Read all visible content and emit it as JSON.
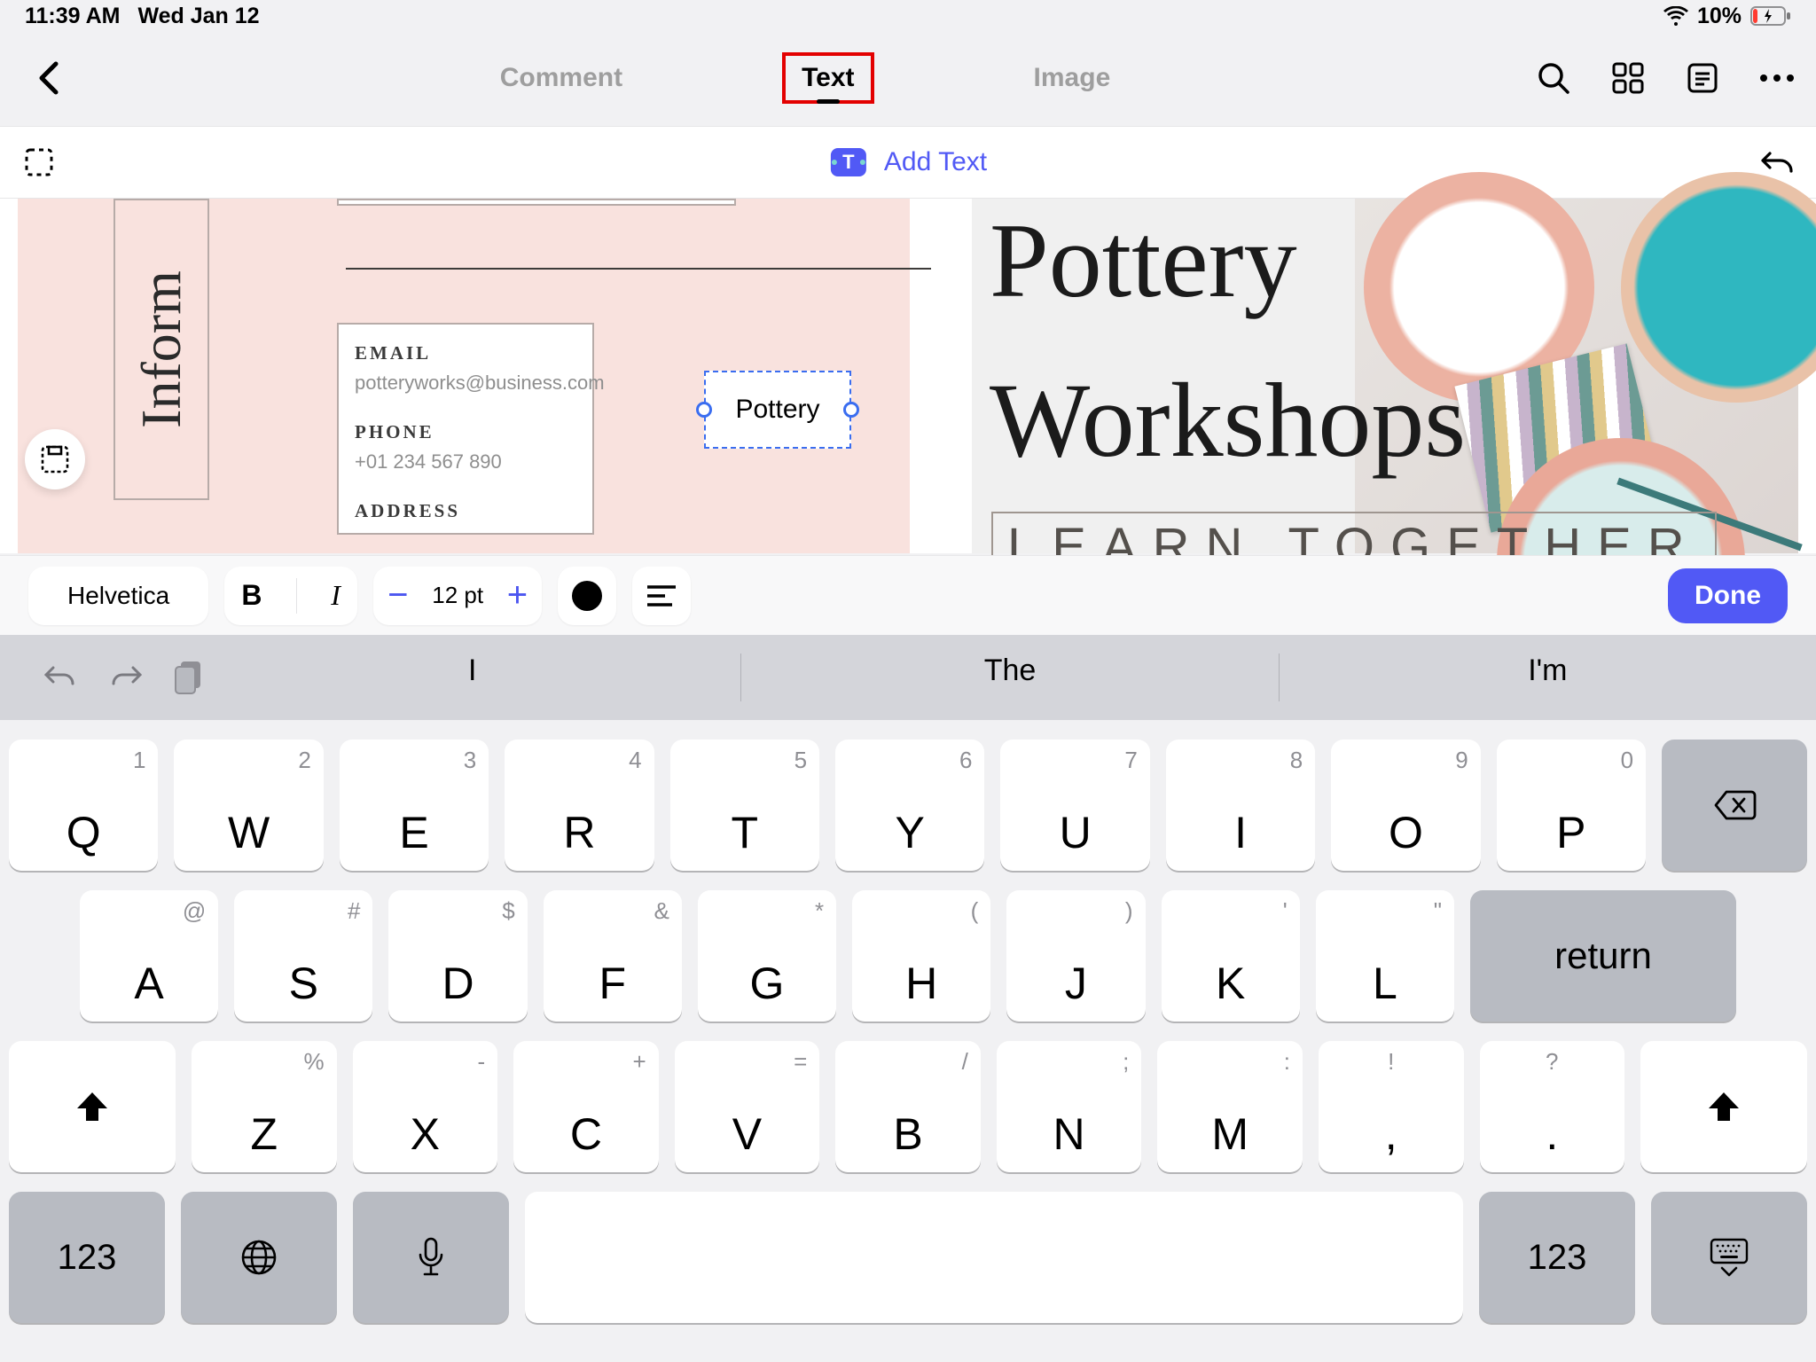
{
  "status": {
    "time": "11:39 AM",
    "date": "Wed Jan 12",
    "battery": "10%"
  },
  "tabs": {
    "comment": "Comment",
    "text": "Text",
    "image": "Image"
  },
  "secbar": {
    "add_text": "Add Text"
  },
  "doc": {
    "vtext": "Inform",
    "email_lbl": "EMAIL",
    "email_val": "potteryworks@business.com",
    "phone_lbl": "PHONE",
    "phone_val": "+01 234 567 890",
    "address_lbl": "ADDRESS",
    "sel_text": "Pottery",
    "hero_l1": "Pottery",
    "hero_l2": "Workshops",
    "learn": "LEARN TOGETHER"
  },
  "fmt": {
    "font": "Helvetica",
    "bold": "B",
    "italic": "I",
    "size": "12 pt",
    "done": "Done"
  },
  "pred": {
    "w1": "I",
    "w2": "The",
    "w3": "I'm"
  },
  "kb": {
    "row1": [
      {
        "m": "Q",
        "a": "1"
      },
      {
        "m": "W",
        "a": "2"
      },
      {
        "m": "E",
        "a": "3"
      },
      {
        "m": "R",
        "a": "4"
      },
      {
        "m": "T",
        "a": "5"
      },
      {
        "m": "U",
        "a": "7"
      },
      {
        "m": "I",
        "a": "8"
      },
      {
        "m": "O",
        "a": "9"
      },
      {
        "m": "P",
        "a": "0"
      }
    ],
    "y": {
      "m": "Y",
      "a": "6"
    },
    "row2": [
      {
        "m": "A",
        "a": "@"
      },
      {
        "m": "S",
        "a": "#"
      },
      {
        "m": "D",
        "a": "$"
      },
      {
        "m": "F",
        "a": "&"
      },
      {
        "m": "G",
        "a": "*"
      },
      {
        "m": "H",
        "a": "("
      },
      {
        "m": "J",
        "a": ")"
      },
      {
        "m": "K",
        "a": "'"
      },
      {
        "m": "L",
        "a": "\""
      }
    ],
    "return": "return",
    "row3": [
      {
        "m": "Z",
        "a": "%"
      },
      {
        "m": "X",
        "a": "-"
      },
      {
        "m": "C",
        "a": "+"
      },
      {
        "m": "V",
        "a": "="
      },
      {
        "m": "B",
        "a": "/"
      },
      {
        "m": "N",
        "a": ";"
      },
      {
        "m": "M",
        "a": ":"
      },
      {
        "m": ",",
        "a": "!"
      },
      {
        "m": ".",
        "a": "?"
      }
    ],
    "num": "123"
  }
}
